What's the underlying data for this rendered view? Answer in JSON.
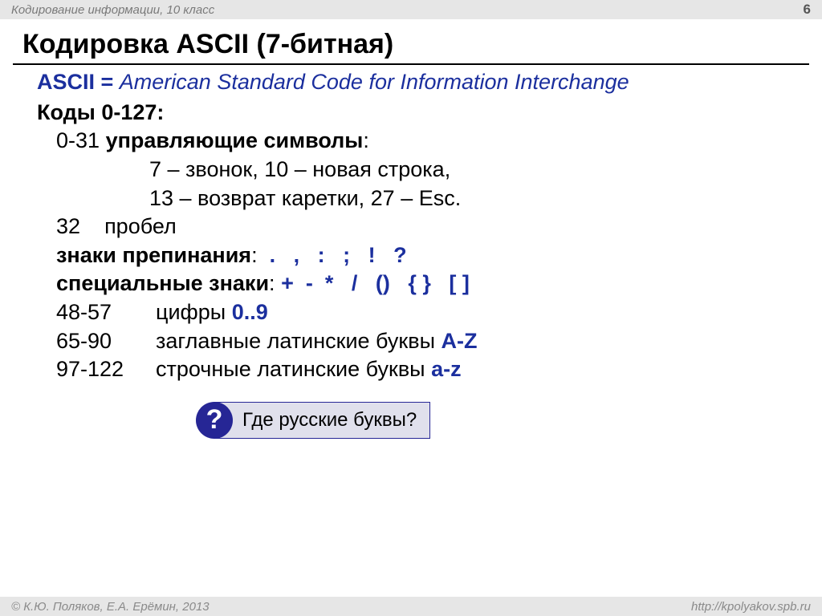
{
  "header": {
    "topic": "Кодирование информации, 10 класс",
    "page_num": "6"
  },
  "title": "Кодировка ASCII (7-битная)",
  "line1": {
    "term": "ASCII = ",
    "expansion": "American Standard Code for Information Interchange"
  },
  "line2": "Коды 0-127:",
  "ctrl": {
    "range": "0-31",
    "label": "управляющие символы",
    "colon": ":",
    "ex1": "7 – звонок, 10 – новая строка,",
    "ex2": "13 – возврат каретки, 27 – Esc."
  },
  "space": {
    "code": "32",
    "label": "пробел"
  },
  "punct": {
    "label": "знаки препинания",
    "colon": ":",
    "symbols": "  .   ,   :   ;   !   ?"
  },
  "special": {
    "label": "специальные знаки",
    "colon": ":",
    "symbols": " +  -  *   /   ()   { }   [ ]"
  },
  "digits": {
    "range": "48-57",
    "label": "цифры ",
    "val": "0..9"
  },
  "upper": {
    "range": "65-90",
    "label": "заглавные латинские буквы ",
    "val": "A-Z"
  },
  "lower": {
    "range": "97-122",
    "label": "строчные латинские буквы ",
    "val": "a-z"
  },
  "question": {
    "icon": "?",
    "text": "Где русские буквы?"
  },
  "footer": {
    "copyright": "© К.Ю. Поляков, Е.А. Ерёмин, 2013",
    "url": "http://kpolyakov.spb.ru"
  }
}
